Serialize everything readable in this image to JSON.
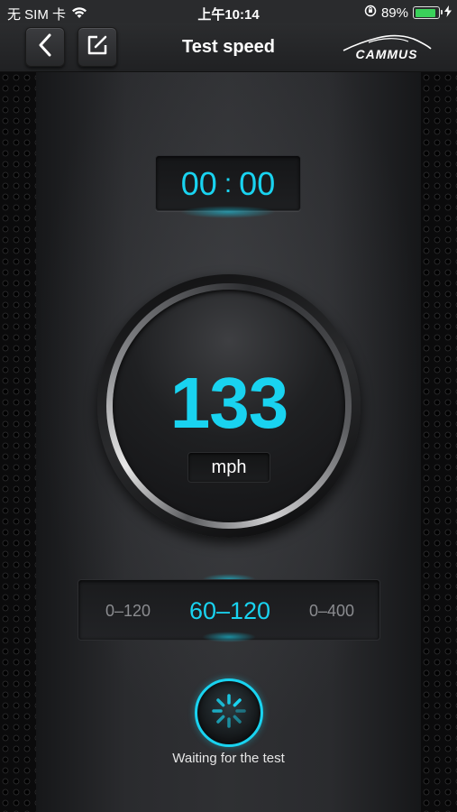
{
  "status_bar": {
    "carrier": "无 SIM 卡",
    "time": "上午10:14",
    "battery_percent": "89%",
    "battery_level": 0.89,
    "icons": [
      "wifi-icon",
      "orientation-lock-icon",
      "battery-icon",
      "charging-bolt-icon"
    ]
  },
  "nav": {
    "back_icon": "chevron-left-icon",
    "edit_icon": "edit-square-icon",
    "title": "Test speed",
    "brand": "CAMMUS"
  },
  "timer": {
    "minutes": "00",
    "separator": ":",
    "seconds": "00"
  },
  "gauge": {
    "speed": "133",
    "unit": "mph"
  },
  "modes": {
    "items": [
      {
        "label": "0–120",
        "active": false
      },
      {
        "label": "60–120",
        "active": true
      },
      {
        "label": "0–400",
        "active": false
      }
    ]
  },
  "action": {
    "icon": "loading-spinner-icon",
    "status": "Waiting for the test"
  },
  "colors": {
    "accent": "#19d3f0",
    "background": "#2f3033",
    "inactive_text": "#8b8c90",
    "battery": "#3ad15a"
  }
}
